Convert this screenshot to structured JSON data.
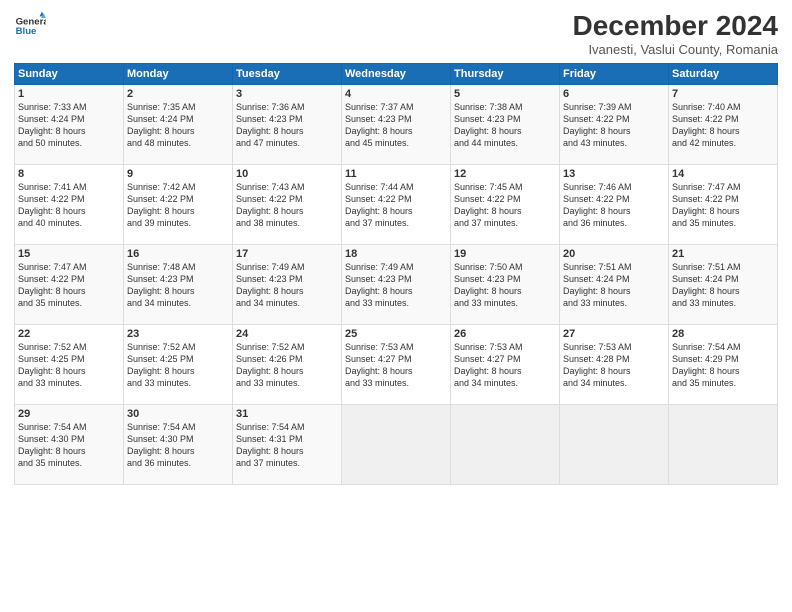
{
  "header": {
    "logo_line1": "General",
    "logo_line2": "Blue",
    "month": "December 2024",
    "location": "Ivanesti, Vaslui County, Romania"
  },
  "days_of_week": [
    "Sunday",
    "Monday",
    "Tuesday",
    "Wednesday",
    "Thursday",
    "Friday",
    "Saturday"
  ],
  "weeks": [
    [
      {
        "day": "1",
        "info": "Sunrise: 7:33 AM\nSunset: 4:24 PM\nDaylight: 8 hours\nand 50 minutes."
      },
      {
        "day": "2",
        "info": "Sunrise: 7:35 AM\nSunset: 4:24 PM\nDaylight: 8 hours\nand 48 minutes."
      },
      {
        "day": "3",
        "info": "Sunrise: 7:36 AM\nSunset: 4:23 PM\nDaylight: 8 hours\nand 47 minutes."
      },
      {
        "day": "4",
        "info": "Sunrise: 7:37 AM\nSunset: 4:23 PM\nDaylight: 8 hours\nand 45 minutes."
      },
      {
        "day": "5",
        "info": "Sunrise: 7:38 AM\nSunset: 4:23 PM\nDaylight: 8 hours\nand 44 minutes."
      },
      {
        "day": "6",
        "info": "Sunrise: 7:39 AM\nSunset: 4:22 PM\nDaylight: 8 hours\nand 43 minutes."
      },
      {
        "day": "7",
        "info": "Sunrise: 7:40 AM\nSunset: 4:22 PM\nDaylight: 8 hours\nand 42 minutes."
      }
    ],
    [
      {
        "day": "8",
        "info": "Sunrise: 7:41 AM\nSunset: 4:22 PM\nDaylight: 8 hours\nand 40 minutes."
      },
      {
        "day": "9",
        "info": "Sunrise: 7:42 AM\nSunset: 4:22 PM\nDaylight: 8 hours\nand 39 minutes."
      },
      {
        "day": "10",
        "info": "Sunrise: 7:43 AM\nSunset: 4:22 PM\nDaylight: 8 hours\nand 38 minutes."
      },
      {
        "day": "11",
        "info": "Sunrise: 7:44 AM\nSunset: 4:22 PM\nDaylight: 8 hours\nand 37 minutes."
      },
      {
        "day": "12",
        "info": "Sunrise: 7:45 AM\nSunset: 4:22 PM\nDaylight: 8 hours\nand 37 minutes."
      },
      {
        "day": "13",
        "info": "Sunrise: 7:46 AM\nSunset: 4:22 PM\nDaylight: 8 hours\nand 36 minutes."
      },
      {
        "day": "14",
        "info": "Sunrise: 7:47 AM\nSunset: 4:22 PM\nDaylight: 8 hours\nand 35 minutes."
      }
    ],
    [
      {
        "day": "15",
        "info": "Sunrise: 7:47 AM\nSunset: 4:22 PM\nDaylight: 8 hours\nand 35 minutes."
      },
      {
        "day": "16",
        "info": "Sunrise: 7:48 AM\nSunset: 4:23 PM\nDaylight: 8 hours\nand 34 minutes."
      },
      {
        "day": "17",
        "info": "Sunrise: 7:49 AM\nSunset: 4:23 PM\nDaylight: 8 hours\nand 34 minutes."
      },
      {
        "day": "18",
        "info": "Sunrise: 7:49 AM\nSunset: 4:23 PM\nDaylight: 8 hours\nand 33 minutes."
      },
      {
        "day": "19",
        "info": "Sunrise: 7:50 AM\nSunset: 4:23 PM\nDaylight: 8 hours\nand 33 minutes."
      },
      {
        "day": "20",
        "info": "Sunrise: 7:51 AM\nSunset: 4:24 PM\nDaylight: 8 hours\nand 33 minutes."
      },
      {
        "day": "21",
        "info": "Sunrise: 7:51 AM\nSunset: 4:24 PM\nDaylight: 8 hours\nand 33 minutes."
      }
    ],
    [
      {
        "day": "22",
        "info": "Sunrise: 7:52 AM\nSunset: 4:25 PM\nDaylight: 8 hours\nand 33 minutes."
      },
      {
        "day": "23",
        "info": "Sunrise: 7:52 AM\nSunset: 4:25 PM\nDaylight: 8 hours\nand 33 minutes."
      },
      {
        "day": "24",
        "info": "Sunrise: 7:52 AM\nSunset: 4:26 PM\nDaylight: 8 hours\nand 33 minutes."
      },
      {
        "day": "25",
        "info": "Sunrise: 7:53 AM\nSunset: 4:27 PM\nDaylight: 8 hours\nand 33 minutes."
      },
      {
        "day": "26",
        "info": "Sunrise: 7:53 AM\nSunset: 4:27 PM\nDaylight: 8 hours\nand 34 minutes."
      },
      {
        "day": "27",
        "info": "Sunrise: 7:53 AM\nSunset: 4:28 PM\nDaylight: 8 hours\nand 34 minutes."
      },
      {
        "day": "28",
        "info": "Sunrise: 7:54 AM\nSunset: 4:29 PM\nDaylight: 8 hours\nand 35 minutes."
      }
    ],
    [
      {
        "day": "29",
        "info": "Sunrise: 7:54 AM\nSunset: 4:30 PM\nDaylight: 8 hours\nand 35 minutes."
      },
      {
        "day": "30",
        "info": "Sunrise: 7:54 AM\nSunset: 4:30 PM\nDaylight: 8 hours\nand 36 minutes."
      },
      {
        "day": "31",
        "info": "Sunrise: 7:54 AM\nSunset: 4:31 PM\nDaylight: 8 hours\nand 37 minutes."
      },
      {
        "day": "",
        "info": ""
      },
      {
        "day": "",
        "info": ""
      },
      {
        "day": "",
        "info": ""
      },
      {
        "day": "",
        "info": ""
      }
    ]
  ]
}
